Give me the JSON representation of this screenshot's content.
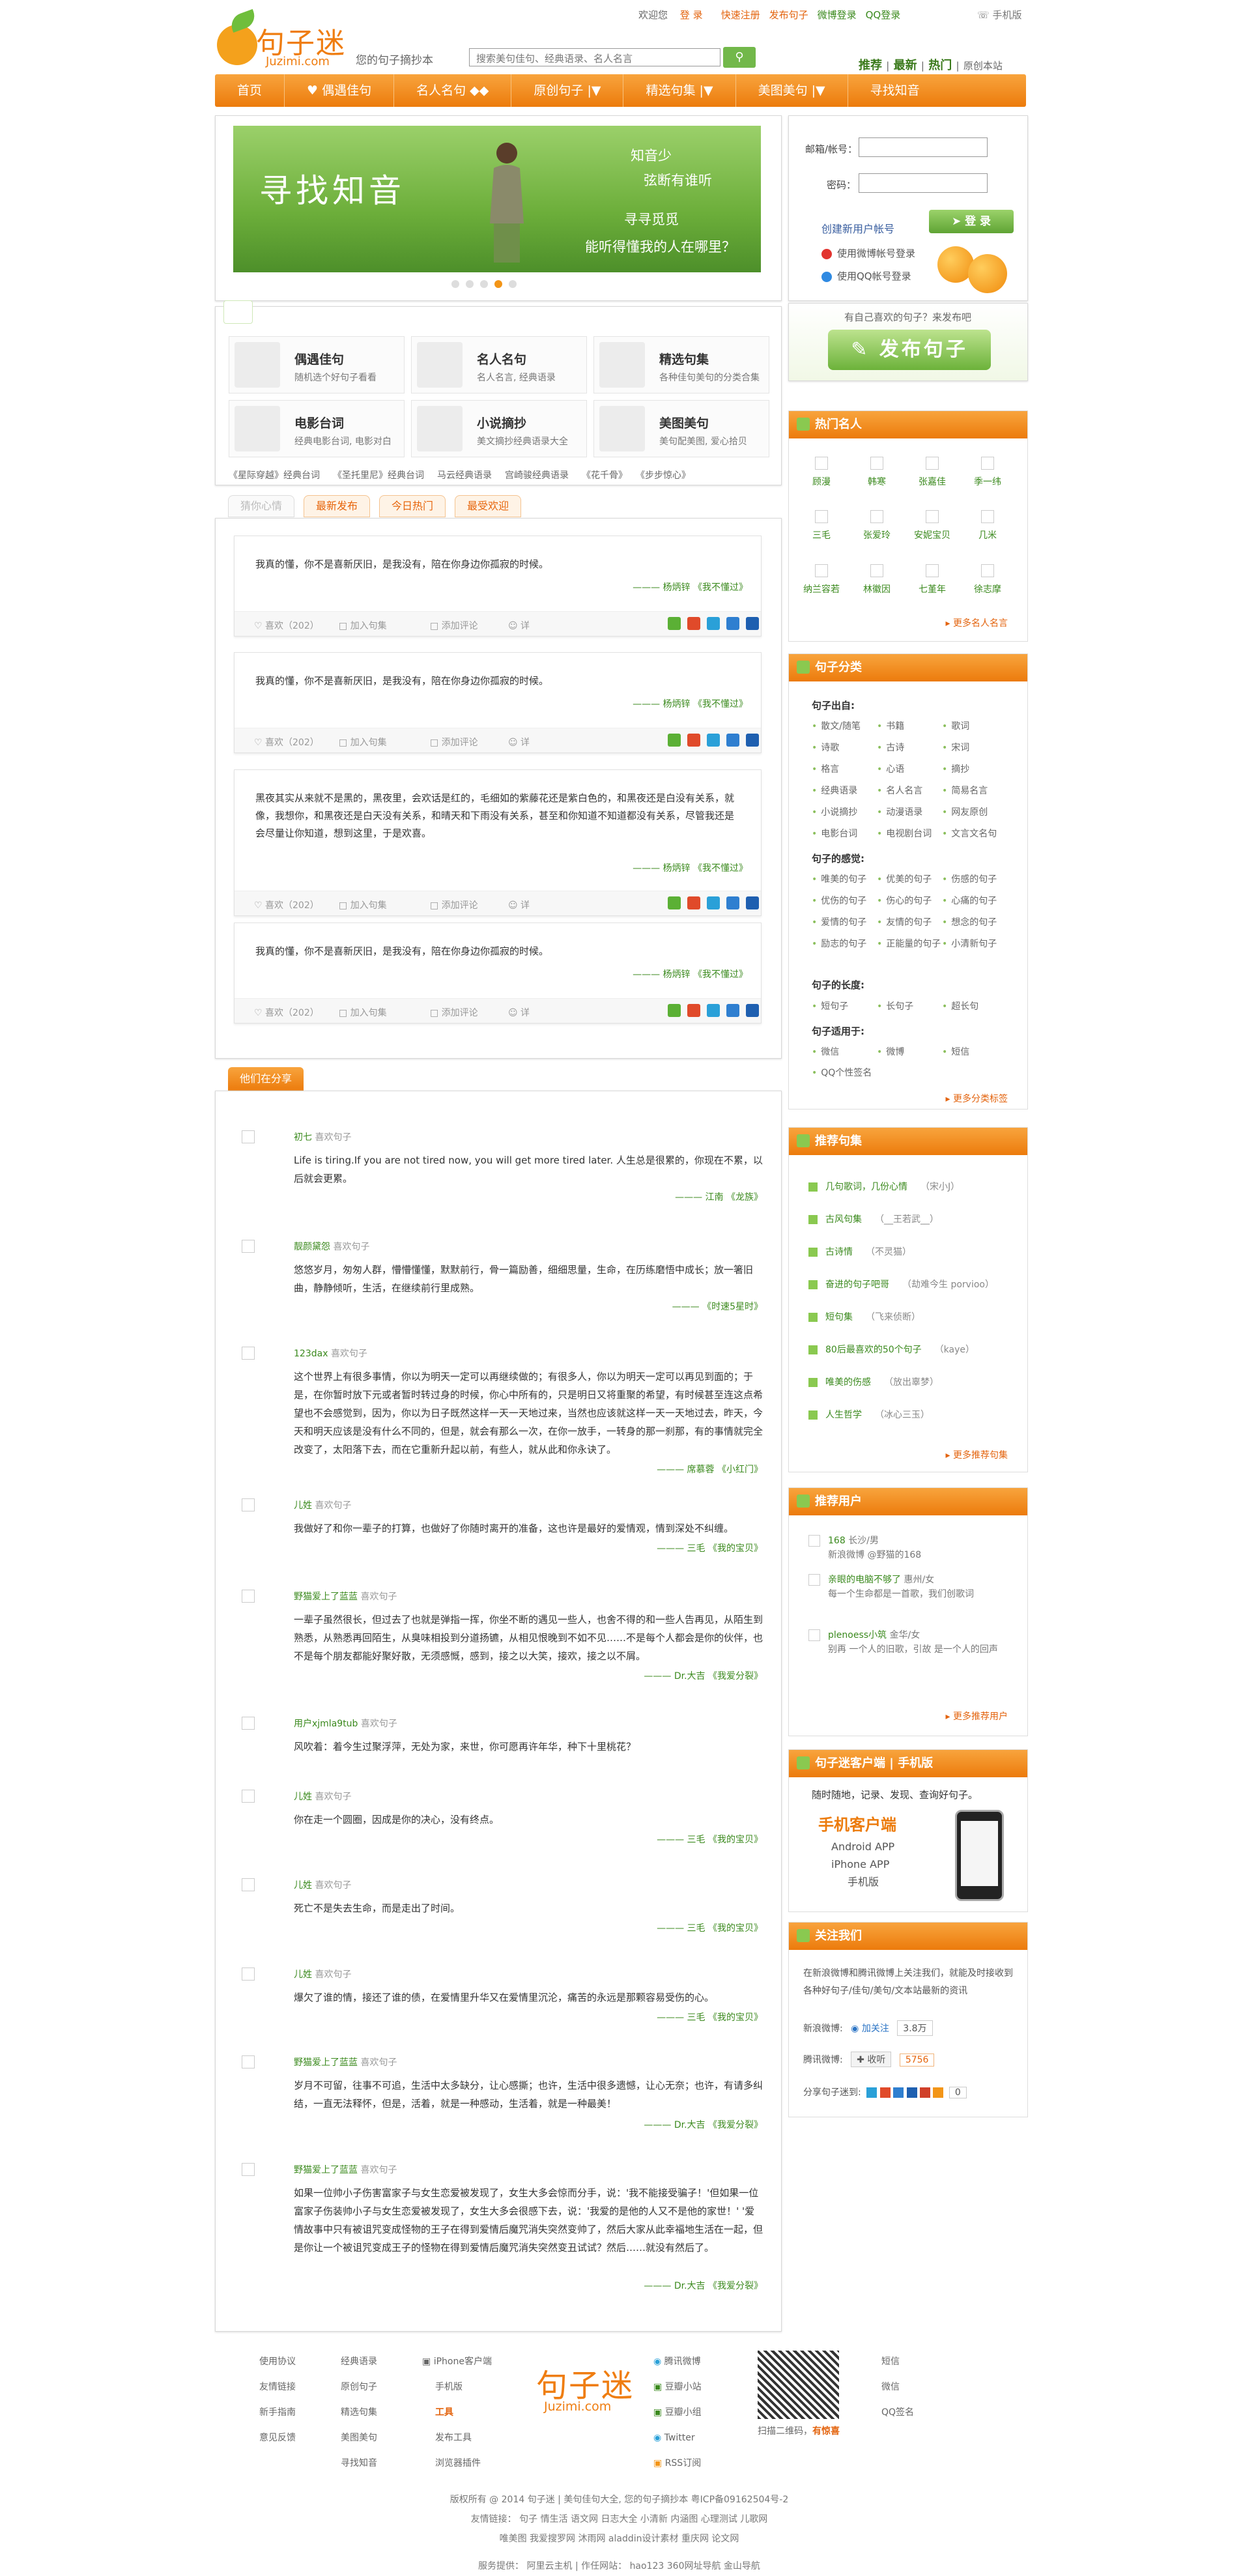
{
  "header": {
    "logo_cn": "句子迷",
    "logo_en": "Juzimi.com",
    "slogan": "您的句子摘抄本",
    "search_placeholder": "搜索美句佳句、经典语录、名人名言",
    "welcome": "欢迎您",
    "login": "登 录",
    "register": "快速注册",
    "publish": "发布句子",
    "weibo_login": "微博登录",
    "qq_login": "QQ登录",
    "mobile": "手机版",
    "quick": [
      "推荐",
      "最新",
      "热门"
    ],
    "quick_sep": "|",
    "original": "原创本站"
  },
  "nav": [
    "首页",
    "偶遇佳句",
    "名人名句",
    "原创句子",
    "精选句集",
    "美图美句",
    "寻找知音"
  ],
  "nav_arrows": [
    "◆◆",
    "|▼",
    "|▼",
    "|▼"
  ],
  "banner": {
    "title": "寻找知音",
    "lines": [
      "知音少",
      "弦断有谁听",
      "寻寻觅觅",
      "能听得懂我的人在哪里？"
    ]
  },
  "login": {
    "label_user": "邮箱/帐号：",
    "label_pass": "密码：",
    "register_link": "创建新用户帐号",
    "button": "登 录",
    "weibo": "使用微博帐号登录",
    "qq": "使用QQ帐号登录"
  },
  "categories": [
    {
      "title": "偶遇佳句",
      "desc": "随机选个好句子看看",
      "icon": "random-icon"
    },
    {
      "title": "名人名句",
      "desc": "名人名言, 经典语录",
      "icon": "person-icon"
    },
    {
      "title": "精选句集",
      "desc": "各种佳句美句的分类合集",
      "icon": "book-icon"
    },
    {
      "title": "电影台词",
      "desc": "经典电影台词, 电影对白",
      "icon": "film-icon"
    },
    {
      "title": "小说摘抄",
      "desc": "美文摘抄经典语录大全",
      "icon": "novel-icon"
    },
    {
      "title": "美图美句",
      "desc": "美句配美图, 爱心拾贝",
      "icon": "picture-icon"
    }
  ],
  "quick_links": [
    "《星际穿越》经典台词",
    "《圣托里尼》经典台词",
    "马云经典语录",
    "宫崎骏经典语录",
    "《花千骨》",
    "《步步惊心》"
  ],
  "tabs": [
    "猜你心情",
    "最新发布",
    "今日热门",
    "最受欢迎"
  ],
  "posts": [
    {
      "text": "我真的懂，你不是喜新厌旧，是我没有，陪在你身边你孤寂的时候。",
      "source": "——— 杨炳锌 《我不懂过》",
      "likes": "喜欢（202）",
      "collect": "加入句集",
      "comment": "添加评论",
      "tag": "详"
    },
    {
      "text": "我真的懂，你不是喜新厌旧，是我没有，陪在你身边你孤寂的时候。",
      "source": "——— 杨炳锌 《我不懂过》",
      "likes": "喜欢（202）",
      "collect": "加入句集",
      "comment": "添加评论",
      "tag": "详"
    },
    {
      "text": "黑夜其实从来就不是黑的，黑夜里，会欢话是红的，毛细如的紫藤花还是紫白色的，和黑夜还是白没有关系，就像，我想你，和黑夜还是白天没有关系，和晴天和下雨没有关系，甚至和你知道不知道都没有关系，尽管我还是会尽量让你知道，想到这里，于是欢喜。",
      "source": "——— 杨炳锌 《我不懂过》",
      "likes": "喜欢（202）",
      "collect": "加入句集",
      "comment": "添加评论",
      "tag": "详"
    },
    {
      "text": "我真的懂，你不是喜新厌旧，是我没有，陪在你身边你孤寂的时候。",
      "source": "——— 杨炳锌 《我不懂过》",
      "likes": "喜欢（202）",
      "collect": "加入句集",
      "comment": "添加评论",
      "tag": "详"
    }
  ],
  "share_tab": "他们在分享",
  "shares": [
    {
      "user": "初七",
      "action": "喜欢句子",
      "text": "Life is tiring.If you are not tired now, you will get more tired later. 人生总是很累的，你现在不累，以后就会更累。",
      "source": "——— 江南 《龙族》"
    },
    {
      "user": "靓颜黛怨",
      "action": "喜欢句子",
      "text": "悠悠岁月，匆匆人群，懵懵懂懂，默默前行，骨一篇励善，细细思量，生命，在历练磨悟中成长；放一箸旧曲，静静倾听，生活，在继续前行里成熟。",
      "source": "——— 《时速5星时》"
    },
    {
      "user": "123dax",
      "action": "喜欢句子",
      "text": "这个世界上有很多事情，你以为明天一定可以再继续做的；有很多人，你以为明天一定可以再见到面的；于是，在你暂时放下元或者暂时转过身的时候，你心中所有的，只是明日又将重聚的希望，有时候甚至连这点希望也不会感觉到，因为，你以为日子既然这样一天一天地过来，当然也应该就这样一天一天地过去，昨天，今天和明天应该是没有什么不同的，但是，就会有那么一次，在你一放手，一转身的那一刹那，有的事情就完全改变了，太阳落下去，而在它重新升起以前，有些人，就从此和你永诀了。",
      "source": "——— 席慕蓉 《小红门》"
    },
    {
      "user": "儿姓",
      "action": "喜欢句子",
      "text": "我做好了和你一辈子的打算，也做好了你随时离开的准备，这也许是最好的爱情观，情到深处不纠缠。",
      "source": "——— 三毛 《我的宝贝》"
    },
    {
      "user": "野猫爱上了蓝蓝",
      "action": "喜欢句子",
      "text": "一辈子虽然很长，但过去了也就是弹指一挥，你坐不断的遇见一些人，也舍不得的和一些人告再见，从陌生到熟悉，从熟悉再回陌生，从臭味相投到分道扬镳，从相见恨晚到不如不见……不是每个人都会是你的伙伴，也不是每个朋友都能好聚好散，无须感慨，感到，接之以大笑，接欢，接之以不屑。",
      "source": "——— Dr.大吉 《我爱分裂》"
    },
    {
      "user": "用户xjmla9tub",
      "action": "喜欢句子",
      "text": "风吹着：着今生过聚浮萍，无处为家，来世，你可愿再许年华，种下十里桃花？",
      "source": ""
    },
    {
      "user": "儿姓",
      "action": "喜欢句子",
      "text": "你在走一个圆圈，因成是你的决心，没有终点。",
      "source": "——— 三毛 《我的宝贝》"
    },
    {
      "user": "儿姓",
      "action": "喜欢句子",
      "text": "死亡不是失去生命，而是走出了时间。",
      "source": "——— 三毛 《我的宝贝》"
    },
    {
      "user": "儿姓",
      "action": "喜欢句子",
      "text": "爆欠了谁的情，接还了谁的债，在爱情里升华又在爱情里沉沦，痛苦的永远是那颗容易受伤的心。",
      "source": "——— 三毛 《我的宝贝》"
    },
    {
      "user": "野猫爱上了蓝蓝",
      "action": "喜欢句子",
      "text": "岁月不可留，往事不可追，生活中太多缺分，让心感撕；也许，生活中很多遗憾，让心无奈；也许，有请多纠结，一直无法释怀，但是，活着，就是一种感动，生活着，就是一种最美！",
      "source": "——— Dr.大吉 《我爱分裂》"
    },
    {
      "user": "野猫爱上了蓝蓝",
      "action": "喜欢句子",
      "text": "如果一位帅小子伤害富家子与女生恋爱被发现了，女生大多会惊而分手，说：'我不能接受骗子！'但如果一位富家子伤装帅小子与女生恋爱被发现了，女生大多会很感下去，说：'我爱的是他的人又不是他的家世！' '爱情故事中只有被诅咒变成怪物的王子在得到爱情后魔咒消失突然变帅了，然后大家从此幸福地生活在一起，但是你让一个被诅咒变成王子的怪物在得到爱情后魔咒消失突然变丑试试？然后……就没有然后了。",
      "source": "——— Dr.大吉 《我爱分裂》"
    }
  ],
  "sidebar": {
    "publish_question": "有自己喜欢的句子？来发布吧",
    "publish_button": "发布句子",
    "hot_people_title": "热门名人",
    "hot_people": [
      "顾漫",
      "韩寒",
      "张嘉佳",
      "季一纬",
      "三毛",
      "张爱玲",
      "安妮宝贝",
      "几米",
      "纳兰容若",
      "林徽因",
      "七堇年",
      "徐志摩"
    ],
    "hot_people_more": "更多名人名言",
    "cat_title": "句子分类",
    "from_title": "句子出自:",
    "from": [
      "散文/随笔",
      "书籍",
      "歌词",
      "诗歌",
      "古诗",
      "宋词",
      "格言",
      "心语",
      "摘抄",
      "经典语录",
      "名人名言",
      "简易名言",
      "小说摘抄",
      "动漫语录",
      "网友原创",
      "电影台词",
      "电视剧台词",
      "文言文名句"
    ],
    "feel_title": "句子的感觉:",
    "feel": [
      "唯美的句子",
      "优美的句子",
      "伤感的句子",
      "优伤的句子",
      "伤心的句子",
      "心痛的句子",
      "爱情的句子",
      "友情的句子",
      "想念的句子",
      "励志的句子",
      "正能量的句子",
      "小清新句子"
    ],
    "len_title": "句子的长度:",
    "len": [
      "短句子",
      "长句子",
      "超长句"
    ],
    "use_title": "句子适用于:",
    "use": [
      "微信",
      "微博",
      "短信",
      "QQ个性签名"
    ],
    "cat_more": "更多分类标签",
    "rec_title": "推荐句集",
    "rec": [
      [
        "几句歌词，几份心情",
        "（宋小J）"
      ],
      [
        "古风句集",
        "（__王若武__）"
      ],
      [
        "古诗情",
        "（不灵猫）"
      ],
      [
        "奋进的句子吧哥",
        "（劫难今生 porvioo）"
      ],
      [
        "短句集",
        "（飞来侦断）"
      ],
      [
        "80后最喜欢的50个句子",
        "（kaye）"
      ],
      [
        "唯美的伤感",
        "（放出辜梦）"
      ],
      [
        "人生哲学",
        "（冰心三玉）"
      ]
    ],
    "rec_more": "更多推荐句集",
    "user_title": "推荐用户",
    "users": [
      {
        "name": "168",
        "desc": "长沙/男",
        "sub": "新浪微博 @野猫的168"
      },
      {
        "name": "亲眼的电脑不够了",
        "desc": "惠州/女",
        "sub": "每一个生命都是一首歌，我们创歌词"
      },
      {
        "name": "plenoess小筑",
        "desc": "金华/女",
        "sub": "别再 一个人的旧歌，引故 是一个人的回声"
      }
    ],
    "user_more": "更多推荐用户",
    "app_title": "句子迷客户端 | 手机版",
    "app_intro": "随时随地，记录、发现、查询好句子。",
    "app_name": "手机客户端",
    "app_list": [
      "Android APP",
      "iPhone APP",
      "手机版"
    ],
    "follow_title": "关注我们",
    "follow_desc": "在新浪微博和腾讯微博上关注我们，就能及时接收到各种好句子/佳句/美句/文本站最新的资讯",
    "weibo_label": "新浪微博:",
    "weibo_btn": "加关注",
    "weibo_count": "3.8万",
    "tqq_label": "腾讯微博:",
    "tqq_btn": "收听",
    "tqq_count": "5756",
    "share_label": "分享句子迷到:",
    "share_count": "0"
  },
  "footer": {
    "col1": [
      "使用协议",
      "友情链接",
      "新手指南",
      "意见反馈"
    ],
    "col2": [
      "经典语录",
      "原创句子",
      "精选句集",
      "美图美句",
      "寻找知音"
    ],
    "col3": [
      "iPhone客户端",
      "手机版",
      "工具",
      "发布工具",
      "浏览器插件"
    ],
    "logo_cn": "句子迷",
    "logo_en": "Juzimi.com",
    "col4": [
      "腾讯微博",
      "豆瓣小站",
      "豆瓣小组",
      "Twitter",
      "RSS订阅"
    ],
    "qr_text": "扫描二维码，",
    "qr_bold": "有惊喜",
    "col5": [
      "短信",
      "微信",
      "QQ签名"
    ],
    "copy1": "版权所有 @ 2014 句子迷 | 美句佳句大全, 您的句子摘抄本 粤ICP备09162504号-2",
    "copy2": "友情链接： 句子 情生活 语文网 日志大全 小清新 内涵图 心理测试 儿歌网",
    "copy3": "唯美图 我爱搜罗网 沐雨网 aladdin设计素材 重庆网 论文网",
    "copy4": "服务提供：  阿里云主机  |  作任网站：  hao123 360网址导航 金山导航"
  }
}
